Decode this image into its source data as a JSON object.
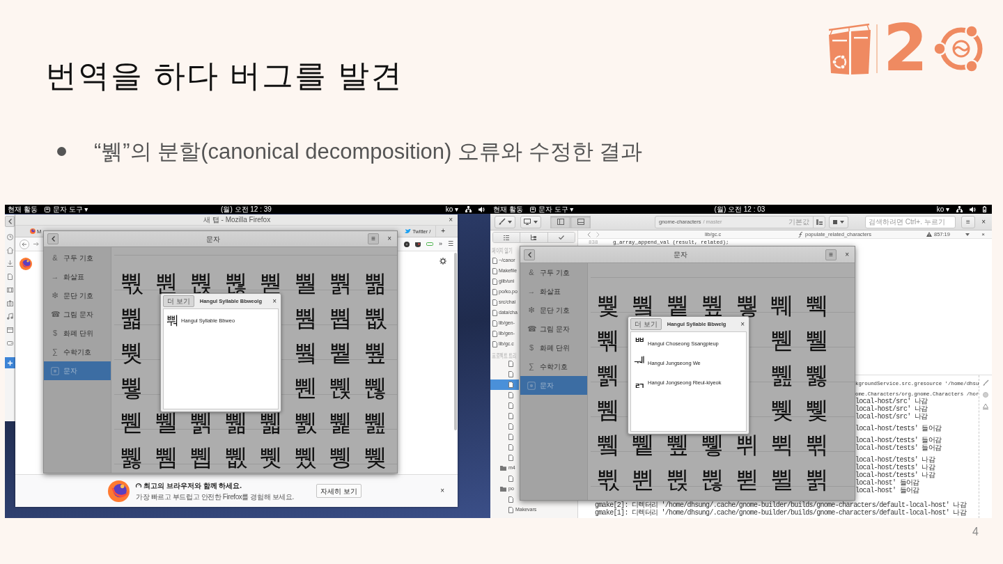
{
  "slide": {
    "title": "번역을 하다 버그를 발견",
    "logo_text": "2",
    "bullet": "“뷁”의 분할(canonical decomposition) 오류와 수정한 결과",
    "page_number": "4"
  },
  "screenshots": [
    {
      "top_bar": {
        "activities": "현재 활동",
        "app_menu": "문자 도구 ▾",
        "clock": "(월) 오전 12 : 39",
        "language": "ko ▾"
      },
      "background_window": {
        "kind": "browser",
        "title": "새 탭 - Mozilla Firefox",
        "close": "×",
        "tabs": [
          {
            "label": "M",
            "selected": false
          },
          {
            "label": "Twitter /",
            "selected": false
          }
        ],
        "new_tab": "+",
        "overflow": "»",
        "menu": "☰",
        "notification": {
          "heading": "최고의 브라우저와 함께 하세요.",
          "text": "가장 빠르고 부드럽고 안전한 Firefox를 경험해 보세요.",
          "button": "자세히 보기",
          "close": "×"
        }
      },
      "characters_window": {
        "title": "문자",
        "menu": "≡",
        "close": "×",
        "categories": [
          {
            "icon": "&",
            "label": "구두 기호",
            "selected": false
          },
          {
            "icon": "→",
            "label": "화살표",
            "selected": false
          },
          {
            "icon": "❇",
            "label": "문단 기호",
            "selected": false
          },
          {
            "icon": "☎",
            "label": "그림 문자",
            "selected": false
          },
          {
            "icon": "$",
            "label": "화폐 단위",
            "selected": false
          },
          {
            "icon": "∑",
            "label": "수학기호",
            "selected": false
          },
          {
            "label": "문자",
            "selected": true
          }
        ],
        "grid": [
          {
            "cells": [
              "뿫",
              "뿬",
              "뿭",
              "뿮",
              "뿯",
              "뿰",
              "뿱",
              "뿲"
            ]
          },
          {
            "left_of_popover": [
              "뿳"
            ],
            "right_of_popover": [
              "뿸",
              "뿹",
              "뿺"
            ]
          },
          {
            "left_of_popover": [
              "뿻"
            ],
            "right_of_popover": [
              "쀀",
              "쀁",
              "쀂"
            ]
          },
          {
            "left_of_popover": [
              "쀃"
            ],
            "right_of_popover": [
              "쀈",
              "쀉",
              "쀊"
            ]
          },
          {
            "cells": [
              "쀋",
              "쀌",
              "쀍",
              "쀎",
              "쀏",
              "쀐",
              "쀑",
              "쀒"
            ]
          },
          {
            "cells": [
              "쀓",
              "쀔",
              "쀕",
              "쀖",
              "쀗",
              "쀘",
              "쀙",
              "쀚"
            ]
          }
        ],
        "popover": {
          "more": "더 보기",
          "title": "Hangul Syllable Bbweolg",
          "close": "×",
          "items": [
            {
              "glyph": "뿨",
              "name": "Hangul Syllable Bbweo"
            }
          ]
        }
      }
    },
    {
      "top_bar": {
        "activities": "현재 활동",
        "app_menu": "문자 도구 ▾",
        "clock": "(월) 오전 12 : 03",
        "language": "ko ▾"
      },
      "background_window": {
        "kind": "ide",
        "panel_toggles": [
          {
            "kind": "left-panel",
            "on": true
          },
          {
            "kind": "bottom-panel",
            "on": true
          }
        ],
        "project": "gnome-characters",
        "branch": "/ master",
        "configuration": "기본값",
        "search": {
          "placeholder": "검색하려면 Ctrl+. 누르기"
        },
        "menu": "≡",
        "close": "×",
        "open_pages_heading": "페이지 열기",
        "open_pages": [
          "~/canor",
          "Makefile",
          "glib/uni",
          "po/ko.po",
          "src/chai",
          "data/cha",
          "lib/gen-",
          "lib/gen-",
          "lib/gc.c"
        ],
        "project_tree_heading": "프로젝트 트리",
        "project_tree": [
          {
            "children": [
              {
                "kind": "file",
                "selected": false
              },
              {
                "kind": "file",
                "selected": false
              },
              {
                "kind": "file",
                "selected": true
              },
              {
                "kind": "file",
                "selected": false
              },
              {
                "kind": "file",
                "selected": false
              },
              {
                "kind": "file",
                "selected": false
              },
              {
                "kind": "file",
                "selected": false
              },
              {
                "kind": "file",
                "selected": false
              },
              {
                "kind": "file",
                "selected": false
              },
              {
                "kind": "file",
                "selected": false
              }
            ]
          },
          {
            "kind": "folder",
            "label": "m4",
            "selected": false,
            "children": [
              {
                "kind": "file",
                "selected": false
              }
            ]
          },
          {
            "kind": "folder",
            "label": "po",
            "selected": false,
            "children": [
              {
                "kind": "file",
                "selected": false
              },
              {
                "kind": "file",
                "label": "Makevars",
                "selected": false
              }
            ]
          }
        ],
        "editor": {
          "file": "lib/gc.c",
          "symbol": "populate_related_characters",
          "position": "857:19",
          "close": "×",
          "lines": [
            {
              "number": "838",
              "code": "g_array_append_val (result, related);"
            }
          ]
        },
        "terminal": {
          "blocks": [
            [
              {
                "kind": "command",
                "text": "kgroundService.src.gresource '/home/dhsu"
              }
            ],
            [
              {
                "kind": "command",
                "text": "ome.Characters/org.gnome.Characters /hor"
              },
              {
                "kind": "status",
                "text": "local-host/src' 나감"
              },
              {
                "kind": "status",
                "text": "local-host/src' 나감"
              },
              {
                "kind": "status",
                "text": "local-host/src' 나감"
              }
            ],
            [
              {
                "kind": "status",
                "text": "local-host/tests' 들어감"
              }
            ],
            [
              {
                "kind": "status",
                "text": "local-host/tests' 들어감"
              },
              {
                "kind": "status",
                "text": "local-host/tests' 들어감"
              }
            ],
            [
              {
                "kind": "status",
                "text": "local-host/tests' 나감"
              },
              {
                "kind": "status",
                "text": "local-host/tests' 나감"
              },
              {
                "kind": "status",
                "text": "local-host/tests' 나감"
              },
              {
                "kind": "status",
                "text": "local-host' 들어감"
              },
              {
                "kind": "status",
                "text": "local-host' 들어감"
              }
            ]
          ],
          "last_lines": [
            {
              "kind": "status",
              "text": "gmake[2]: 디렉터리 '/home/dhsung/.cache/gnome-builder/builds/gnome-characters/default-local-host' 나감"
            },
            {
              "kind": "status",
              "text": "gmake[1]: 디렉터리 '/home/dhsung/.cache/gnome-builder/builds/gnome-characters/default-local-host' 나감"
            }
          ]
        }
      },
      "characters_window": {
        "title": "문자",
        "menu": "≡",
        "close": "×",
        "categories": [
          {
            "icon": "&",
            "label": "구두 기호",
            "selected": false
          },
          {
            "icon": "→",
            "label": "화살표",
            "selected": false
          },
          {
            "icon": "❇",
            "label": "문단 기호",
            "selected": false
          },
          {
            "icon": "☎",
            "label": "그림 문자",
            "selected": false
          },
          {
            "icon": "$",
            "label": "화폐 단위",
            "selected": false
          },
          {
            "icon": "∑",
            "label": "수학기호",
            "selected": false
          },
          {
            "label": "문자",
            "selected": true
          }
        ],
        "grid": [
          {
            "cells": [
              "뿿",
              "쀀",
              "쀁",
              "쀂",
              "쀃",
              "쀄",
              "쀅"
            ]
          },
          {
            "left_of_popover": [
              "쀆"
            ],
            "right_of_popover": [
              "쀋",
              "쀌"
            ]
          },
          {
            "left_of_popover": [
              "쀍"
            ],
            "right_of_popover": [
              "쀒",
              "쀓"
            ]
          },
          {
            "left_of_popover": [
              "쀔"
            ],
            "right_of_popover": [
              "쀚",
              "쀛"
            ]
          },
          {
            "cells": [
              "쀜",
              "쀝",
              "쀞",
              "쀟",
              "쀠",
              "쀡",
              "쀢"
            ]
          },
          {
            "cells": [
              "쀣",
              "쀤",
              "쀥",
              "쀦",
              "쀧",
              "쀨",
              "쀩"
            ]
          }
        ],
        "popover": {
          "more": "더 보기",
          "title": "Hangul Syllable Bbwelg",
          "close": "×",
          "items": [
            {
              "glyph": "ᄈ",
              "name": "Hangul Choseong Ssangpieup"
            },
            {
              "glyph": "ᅰ",
              "name": "Hangul Jungseong We"
            },
            {
              "glyph": "ᆰ",
              "name": "Hangul Jongseong Rieul-kiyeok"
            }
          ]
        }
      }
    }
  ]
}
